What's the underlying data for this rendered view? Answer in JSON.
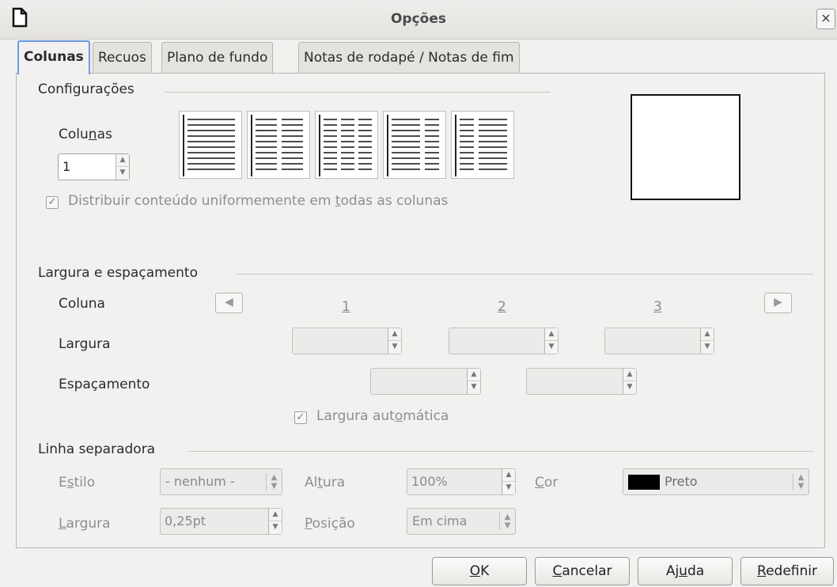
{
  "window": {
    "title": "Opções",
    "close_glyph": "×"
  },
  "tabs": [
    {
      "label": "Colunas",
      "active": true
    },
    {
      "label": "Recuos",
      "active": false
    },
    {
      "label": "Plano de fundo",
      "active": false
    },
    {
      "label": "Notas de rodapé / Notas de fim",
      "active": false
    }
  ],
  "settings": {
    "title": "Configurações",
    "columns_label_pre": "Colu",
    "columns_label_u": "n",
    "columns_label_post": "as",
    "columns_value": "1",
    "presets": [
      "preset-1-column",
      "preset-2-columns",
      "preset-3-columns",
      "preset-2-columns-left-wide",
      "preset-2-columns-right-wide"
    ],
    "distribute_checked": true,
    "distribute_pre": "Distribuir conteúdo uniformemente em ",
    "distribute_u": "t",
    "distribute_post": "odas as colunas"
  },
  "width_spacing": {
    "title": "Largura e espaçamento",
    "column_label": "Coluna",
    "width_label": "Largura",
    "spacing_label": "Espaçamento",
    "col_numbers": [
      "1",
      "2",
      "3"
    ],
    "auto_width_checked": true,
    "auto_width_pre": "Largura aut",
    "auto_width_u": "o",
    "auto_width_post": "mática"
  },
  "separator": {
    "title": "Linha separadora",
    "style_label_pre": "E",
    "style_label_u": "s",
    "style_label_post": "tilo",
    "style_value": "- nenhum -",
    "height_label_pre": "Al",
    "height_label_u": "t",
    "height_label_post": "ura",
    "height_value": "100%",
    "color_label_u": "C",
    "color_label_post": "or",
    "color_value": "Preto",
    "color_swatch": "#000000",
    "width_label_u": "L",
    "width_label_post": "argura",
    "width_value": "0,25pt",
    "position_label_u": "P",
    "position_label_post": "osição",
    "position_value": "Em cima"
  },
  "buttons": {
    "ok_u": "O",
    "ok_post": "K",
    "cancel_u": "C",
    "cancel_post": "ancelar",
    "help_pre": "Aj",
    "help_u": "u",
    "help_post": "da",
    "reset_u": "R",
    "reset_post": "edefinir"
  }
}
